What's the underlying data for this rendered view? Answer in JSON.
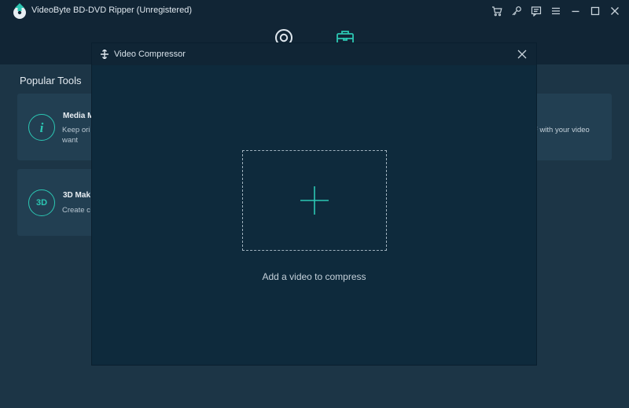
{
  "app": {
    "title": "VideoByte BD-DVD Ripper (Unregistered)"
  },
  "colors": {
    "accent": "#2cc7b3",
    "titlebar": "#112535",
    "background": "#1c3546",
    "card": "#223f52",
    "modal": "#0e2a3c"
  },
  "titlebar": {
    "icons": [
      "cart-icon",
      "key-icon",
      "feedback-icon",
      "menu-icon",
      "minimize-icon",
      "maximize-icon",
      "close-icon"
    ]
  },
  "nav": {
    "icons": [
      "ripper-disc-icon",
      "toolbox-icon"
    ]
  },
  "main": {
    "section_title": "Popular Tools",
    "cards": [
      {
        "icon": "info-icon",
        "name": "Media M",
        "desc_line1": "Keep ori",
        "desc_line2": "want"
      },
      {
        "icon": "3d-icon",
        "icon_text": "3D",
        "name": "3D Mak",
        "desc_line1": "Create c"
      },
      {
        "desc_line1": "F with your video"
      }
    ]
  },
  "modal": {
    "title": "Video Compressor",
    "dropzone_text": "Add a video to compress"
  }
}
